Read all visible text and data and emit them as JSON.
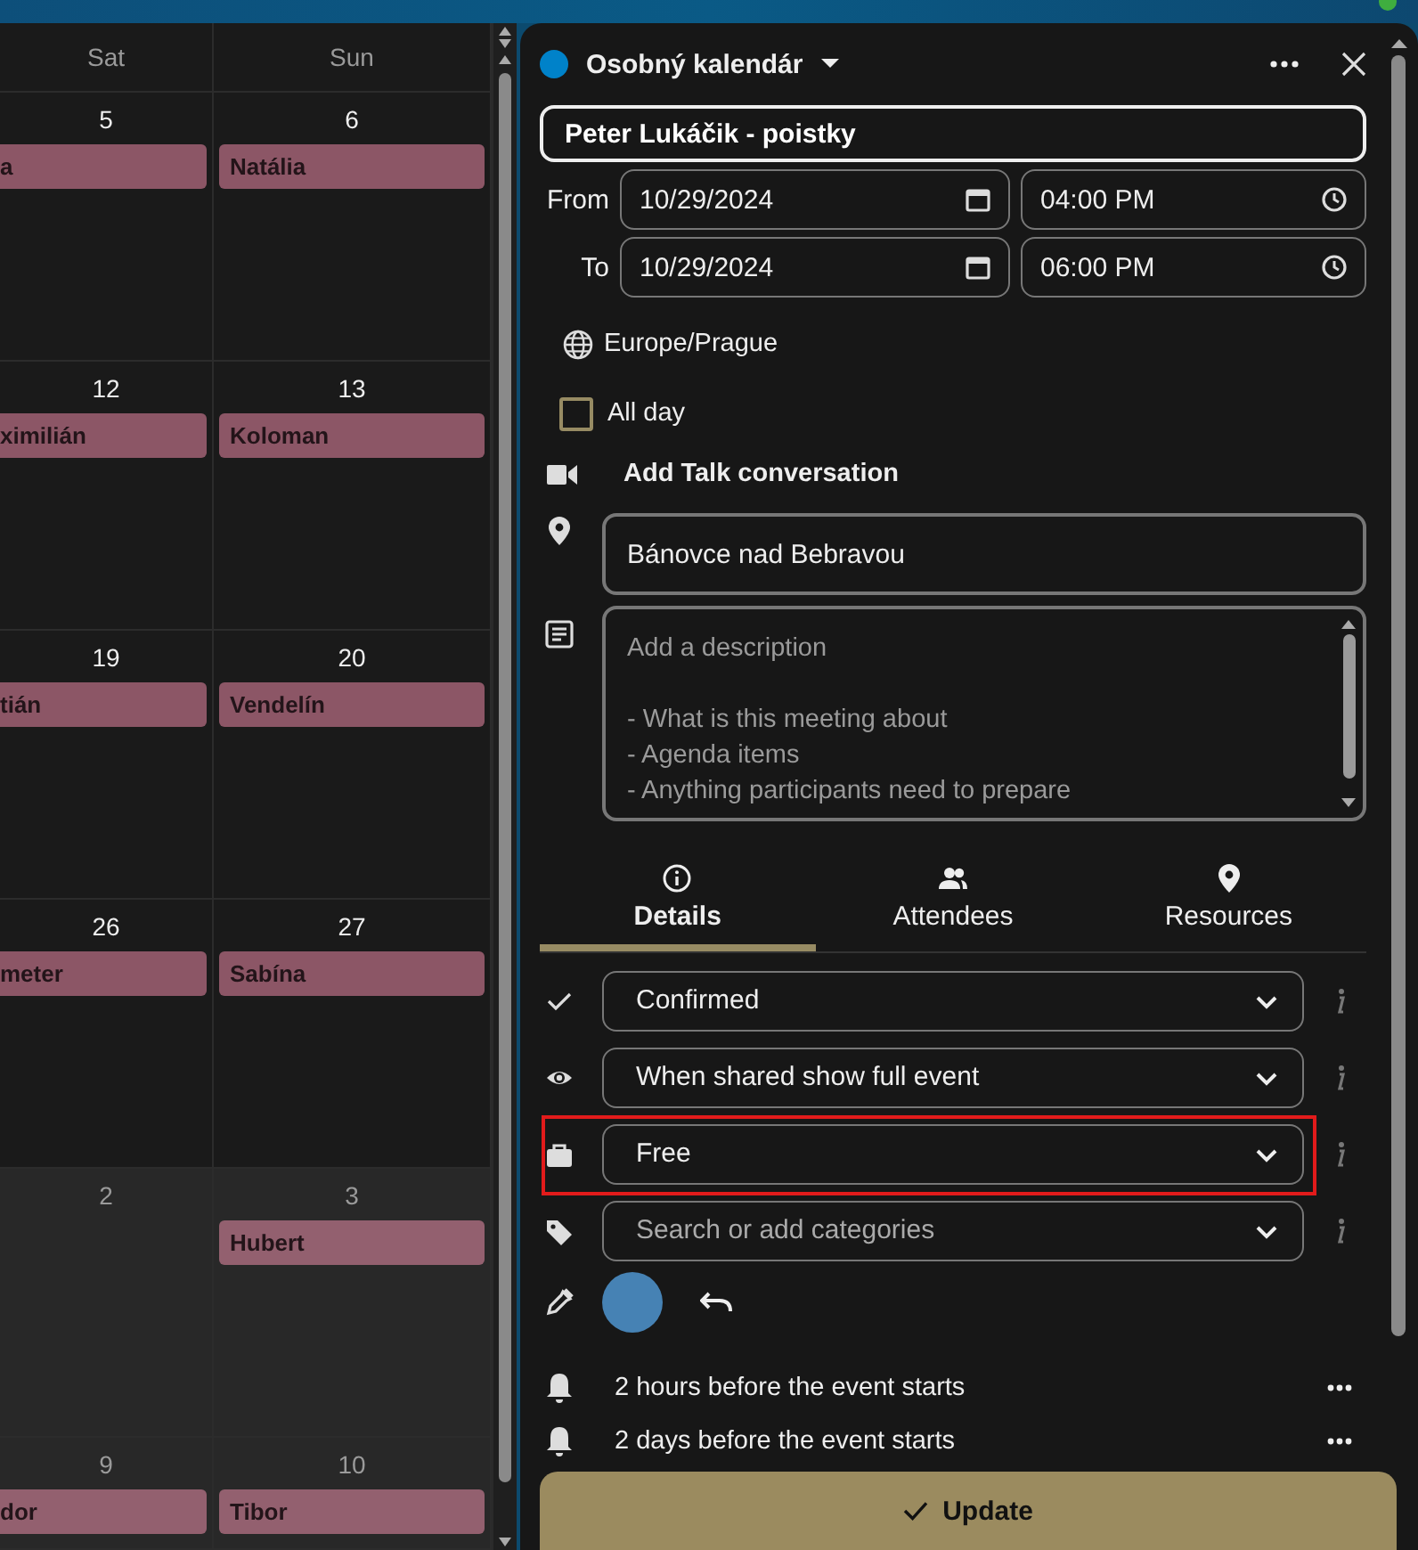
{
  "calendar": {
    "columns": [
      "Sat",
      "Sun"
    ],
    "weeks": [
      {
        "days": [
          {
            "number": "5",
            "other_month": false,
            "events": [
              "a"
            ]
          },
          {
            "number": "6",
            "other_month": false,
            "events": [
              "Natália"
            ]
          }
        ]
      },
      {
        "days": [
          {
            "number": "12",
            "other_month": false,
            "events": [
              "ximilián"
            ]
          },
          {
            "number": "13",
            "other_month": false,
            "events": [
              "Koloman"
            ]
          }
        ]
      },
      {
        "days": [
          {
            "number": "19",
            "other_month": false,
            "events": [
              "tián"
            ]
          },
          {
            "number": "20",
            "other_month": false,
            "events": [
              "Vendelín"
            ]
          }
        ]
      },
      {
        "days": [
          {
            "number": "26",
            "other_month": false,
            "events": [
              "meter"
            ]
          },
          {
            "number": "27",
            "other_month": false,
            "events": [
              "Sabína"
            ]
          }
        ]
      },
      {
        "days": [
          {
            "number": "2",
            "other_month": true
          },
          {
            "number": "3",
            "other_month": true,
            "events": [
              "Hubert"
            ]
          }
        ]
      },
      {
        "days": [
          {
            "number": "9",
            "other_month": true,
            "events": [
              "dor"
            ]
          },
          {
            "number": "10",
            "other_month": true,
            "events": [
              "Tibor"
            ]
          }
        ]
      }
    ]
  },
  "editor": {
    "calendar": {
      "name": "Osobný kalendár",
      "color": "#0082c9"
    },
    "title": "Peter Lukáčik - poistky",
    "from": {
      "label": "From",
      "date": "10/29/2024",
      "time": "04:00 PM"
    },
    "to": {
      "label": "To",
      "date": "10/29/2024",
      "time": "06:00 PM"
    },
    "timezone": "Europe/Prague",
    "all_day": {
      "label": "All day",
      "checked": false
    },
    "talk": "Add Talk conversation",
    "location": "Bánovce nad Bebravou",
    "description": {
      "placeholder": "Add a description\n\n- What is this meeting about\n- Agenda items\n- Anything participants need to prepare"
    },
    "tabs": [
      {
        "label": "Details",
        "selected": true
      },
      {
        "label": "Attendees",
        "selected": false
      },
      {
        "label": "Resources",
        "selected": false
      }
    ],
    "properties": [
      {
        "kind": "status",
        "value": "Confirmed",
        "highlighted": false
      },
      {
        "kind": "visibility",
        "value": "When shared show full event",
        "highlighted": false
      },
      {
        "kind": "availability",
        "value": "Free",
        "highlighted": true
      },
      {
        "kind": "categories",
        "placeholder": "Search or add categories",
        "highlighted": false
      }
    ],
    "color_picker": {
      "color": "#4682b4"
    },
    "reminders": [
      "2 hours before the event starts",
      "2 days before the event starts"
    ],
    "update_button": "Update"
  }
}
